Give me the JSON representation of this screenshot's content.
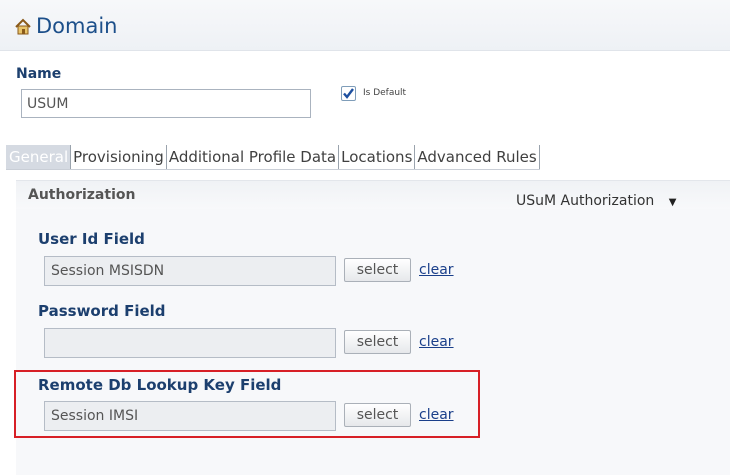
{
  "header": {
    "title": "Domain",
    "icon": "home-icon"
  },
  "name_field": {
    "label": "Name",
    "value": "USUM"
  },
  "is_default": {
    "label": "Is Default",
    "checked": true
  },
  "tabs": [
    {
      "label": "General",
      "active": true
    },
    {
      "label": "Provisioning",
      "active": false
    },
    {
      "label": "Additional Profile Data",
      "active": false
    },
    {
      "label": "Locations",
      "active": false
    },
    {
      "label": "Advanced Rules",
      "active": false
    }
  ],
  "authorization": {
    "title": "Authorization",
    "selected_option": "USuM Authorization",
    "fields": [
      {
        "label": "User Id Field",
        "value": "Session MSISDN",
        "select_label": "select",
        "clear_label": "clear"
      },
      {
        "label": "Password Field",
        "value": "",
        "select_label": "select",
        "clear_label": "clear"
      },
      {
        "label": "Remote Db Lookup Key Field",
        "value": "Session IMSI",
        "select_label": "select",
        "clear_label": "clear",
        "highlighted": true
      }
    ]
  },
  "colors": {
    "accent": "#1c4f8a",
    "highlight": "#d71f26"
  }
}
